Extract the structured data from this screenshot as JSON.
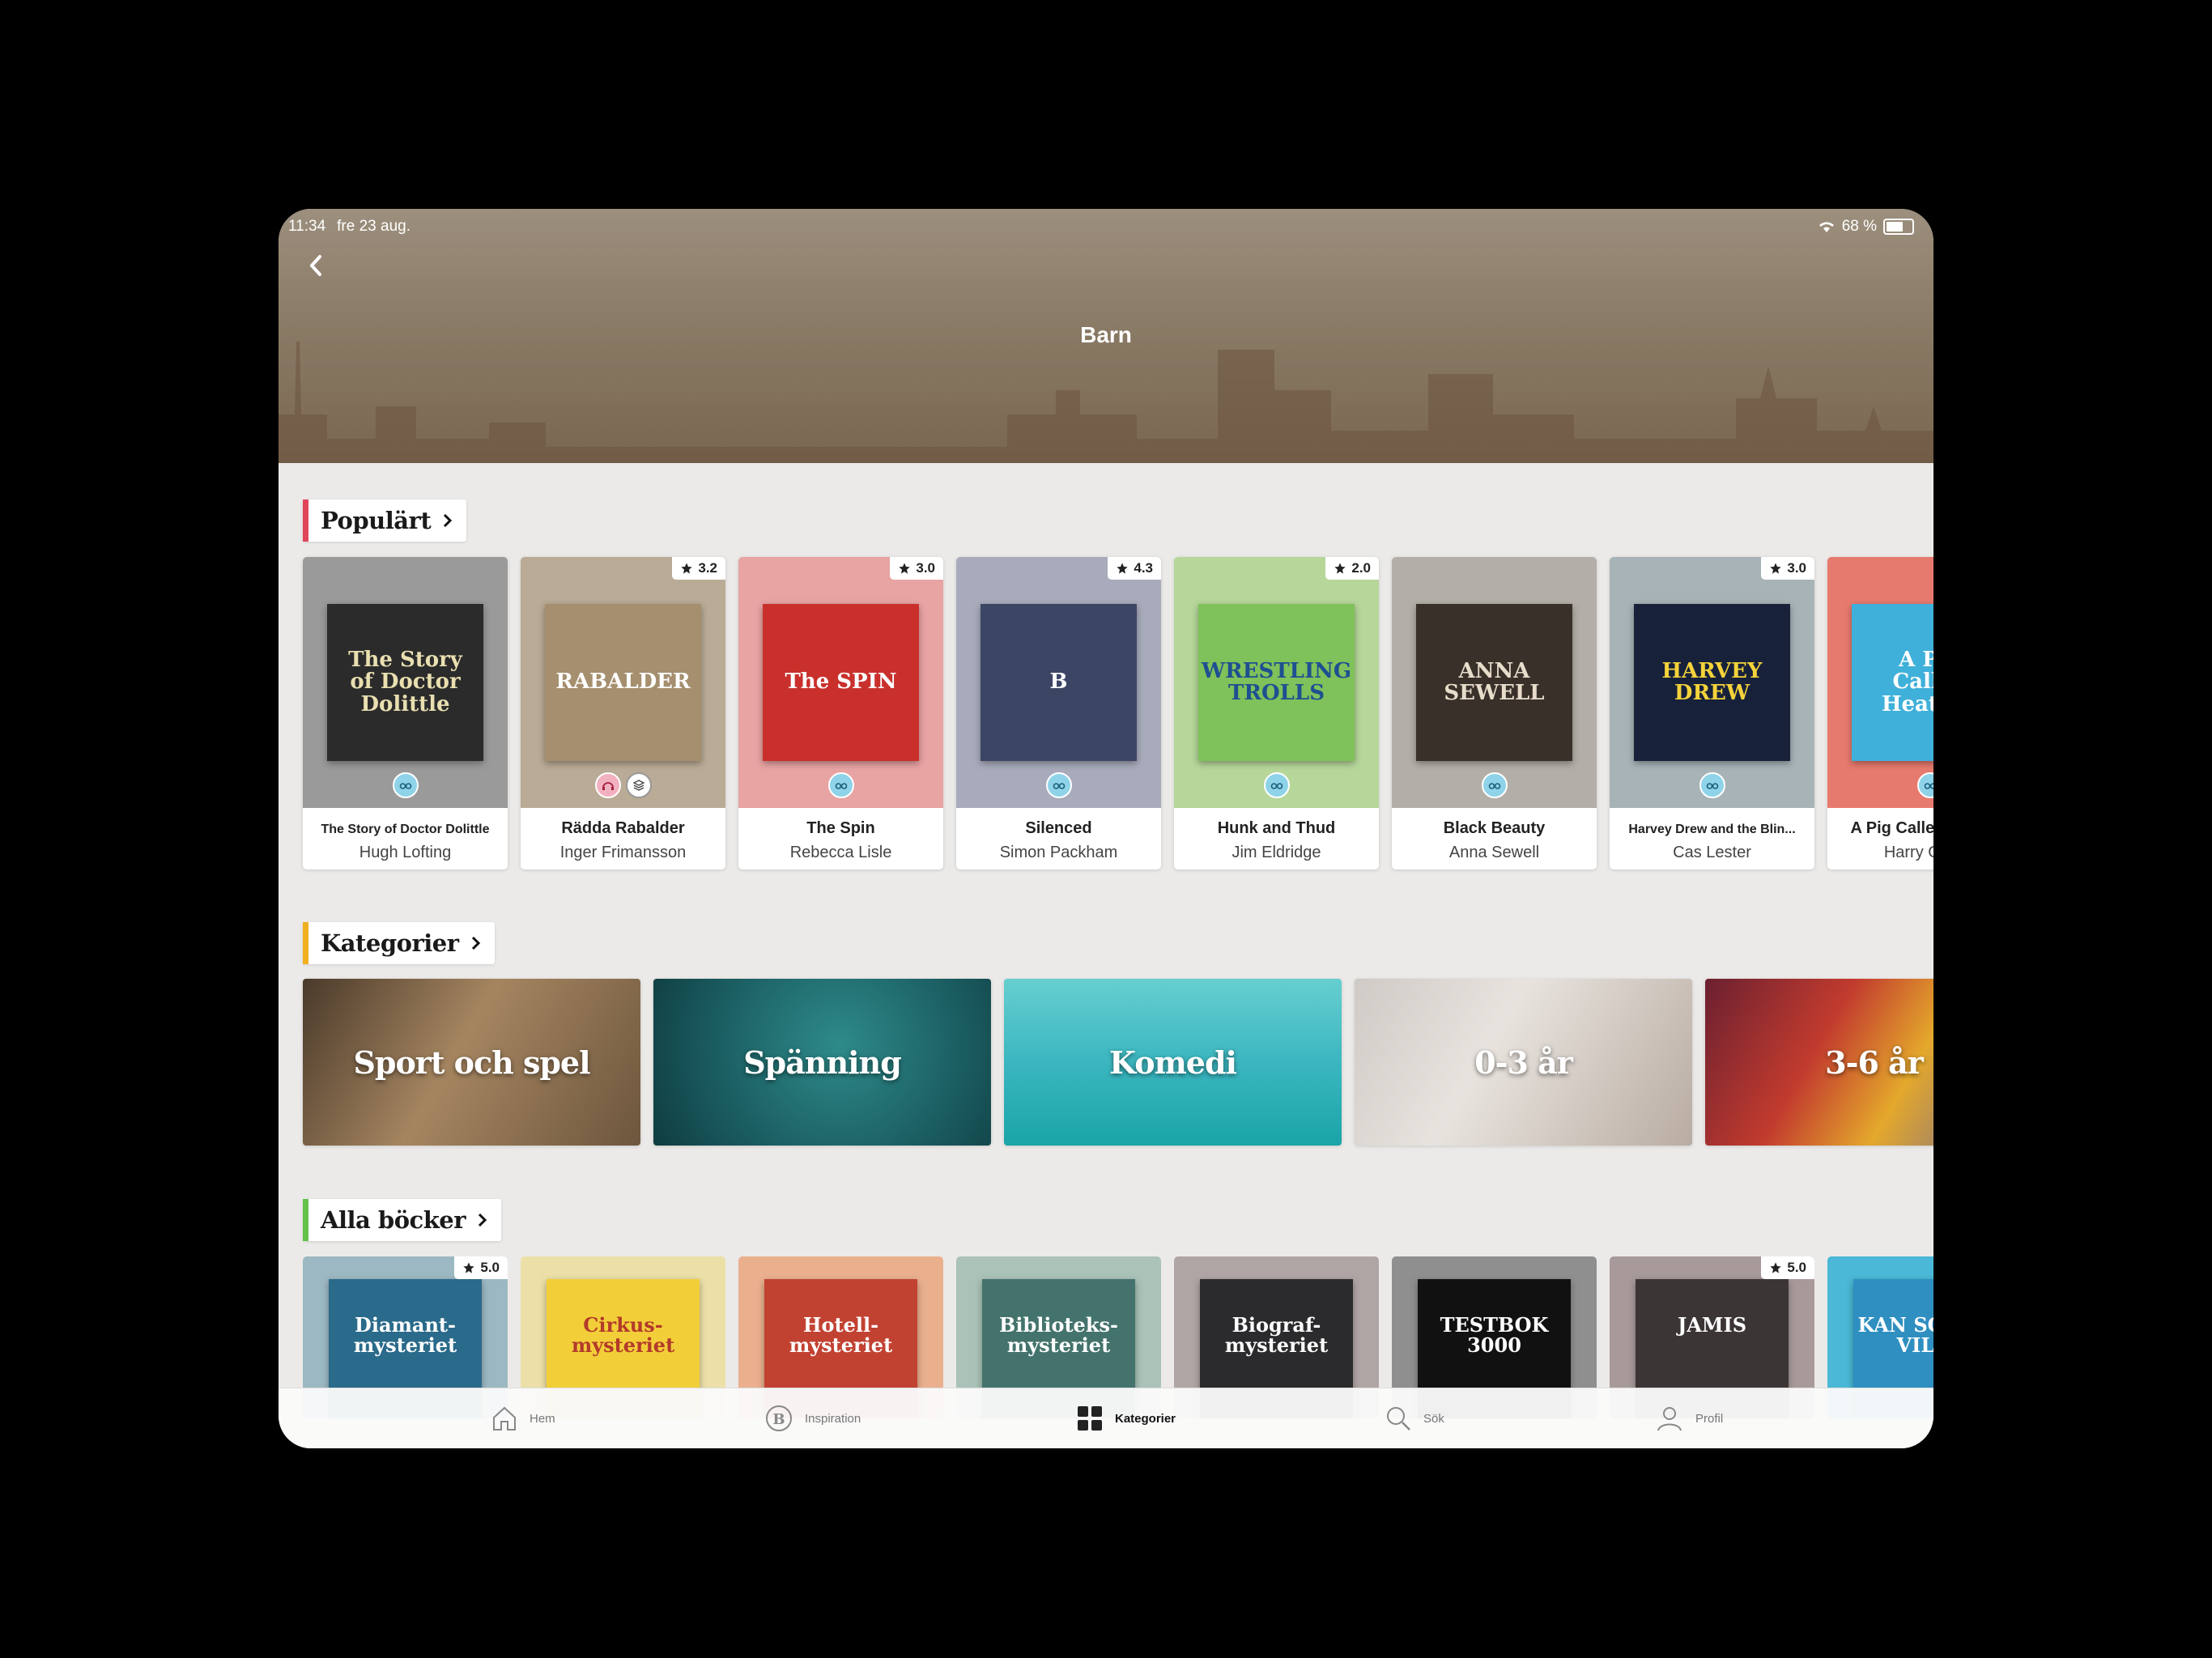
{
  "status": {
    "time": "11:34",
    "date": "fre 23 aug.",
    "battery": "68 %"
  },
  "header": {
    "title": "Barn"
  },
  "popular": {
    "title": "Populärt",
    "accent": "#e0455a",
    "books": [
      {
        "title": "The Story of Doctor Dolittle",
        "author": "Hugh Lofting",
        "rating": "",
        "cover_text": "The Story of Doctor Dolittle",
        "bg": "#9a9a9a",
        "cover": "#2b2b2b",
        "fg": "#e9dfb0",
        "formats": [
          "ebook"
        ]
      },
      {
        "title": "Rädda Rabalder",
        "author": "Inger Frimansson",
        "rating": "3.2",
        "cover_text": "RABALDER",
        "bg": "#b9ab96",
        "cover": "#a58f6f",
        "fg": "#ffffff",
        "formats": [
          "audio",
          "stack"
        ]
      },
      {
        "title": "The Spin",
        "author": "Rebecca Lisle",
        "rating": "3.0",
        "cover_text": "The SPIN",
        "bg": "#e8a3a3",
        "cover": "#c9302c",
        "fg": "#ffffff",
        "formats": [
          "ebook"
        ]
      },
      {
        "title": "Silenced",
        "author": "Simon Packham",
        "rating": "4.3",
        "cover_text": "B",
        "bg": "#a8abbb",
        "cover": "#3c4564",
        "fg": "#ffffff",
        "formats": [
          "ebook"
        ]
      },
      {
        "title": "Hunk and Thud",
        "author": "Jim Eldridge",
        "rating": "2.0",
        "cover_text": "WRESTLING TROLLS",
        "bg": "#b6d69a",
        "cover": "#7fc15a",
        "fg": "#1e4f91",
        "formats": [
          "ebook"
        ]
      },
      {
        "title": "Black Beauty",
        "author": "Anna Sewell",
        "rating": "",
        "cover_text": "ANNA SEWELL",
        "bg": "#b3aea8",
        "cover": "#3a302a",
        "fg": "#e8dccb",
        "formats": [
          "ebook"
        ]
      },
      {
        "title": "Harvey Drew and the Blin...",
        "author": "Cas Lester",
        "rating": "3.0",
        "cover_text": "HARVEY DREW",
        "bg": "#a7b3b7",
        "cover": "#17213a",
        "fg": "#f5d33a",
        "formats": [
          "ebook"
        ]
      },
      {
        "title": "A Pig Called Heather",
        "author": "Harry Oulton",
        "rating": "",
        "cover_text": "A Pig Called Heather",
        "bg": "#e77a6e",
        "cover": "#3fb0d9",
        "fg": "#ffffff",
        "formats": [
          "ebook"
        ]
      }
    ]
  },
  "categories": {
    "title": "Kategorier",
    "accent": "#f0b020",
    "items": [
      {
        "label": "Sport och spel",
        "bg": "linear-gradient(120deg,#4a3a2a 0%,#a58560 45%,#6d563d 100%)"
      },
      {
        "label": "Spänning",
        "bg": "radial-gradient(circle at 55% 40%,#2e8a8a 0%,#1a5c60 60%,#0f3c40 100%)"
      },
      {
        "label": "Komedi",
        "bg": "linear-gradient(180deg,#66cfd0 0%,#3bb6c0 50%,#1aa5a8 100%)"
      },
      {
        "label": "0-3 år",
        "bg": "linear-gradient(120deg,#cfcac5 0%,#e8e3de 40%,#b9aca2 100%)"
      },
      {
        "label": "3-6 år",
        "bg": "linear-gradient(120deg,#6b2030 0%,#c23b2e 35%,#e4a82c 60%,#5a5ba6 100%)"
      }
    ]
  },
  "all_books": {
    "title": "Alla böcker",
    "accent": "#62c24a",
    "books": [
      {
        "rating": "5.0",
        "cover_text": "Diamant-mysteriet",
        "bg": "#9cb8c2",
        "cover": "#2a6a8a",
        "fg": "#ffffff"
      },
      {
        "rating": "",
        "cover_text": "Cirkus-mysteriet",
        "bg": "#ece0a8",
        "cover": "#f2cf38",
        "fg": "#b33a2b"
      },
      {
        "rating": "",
        "cover_text": "Hotell-mysteriet",
        "bg": "#eab08e",
        "cover": "#c24232",
        "fg": "#ffffff"
      },
      {
        "rating": "",
        "cover_text": "Biblioteks-mysteriet",
        "bg": "#aac2b8",
        "cover": "#43736c",
        "fg": "#ffffff"
      },
      {
        "rating": "",
        "cover_text": "Biograf-mysteriet",
        "bg": "#b0a5a5",
        "cover": "#2b2a2c",
        "fg": "#ffffff"
      },
      {
        "rating": "",
        "cover_text": "TESTBOK 3000",
        "bg": "#8f8f8f",
        "cover": "#111111",
        "fg": "#ffffff"
      },
      {
        "rating": "5.0",
        "cover_text": "JAMIS",
        "bg": "#a89a9a",
        "cover": "#3c3535",
        "fg": "#ffffff"
      },
      {
        "rating": "",
        "cover_text": "KAN SOM SÅ VILLE",
        "bg": "#4ab8d6",
        "cover": "#2f8fc0",
        "fg": "#ffffff"
      }
    ]
  },
  "tabs": [
    {
      "label": "Hem",
      "icon": "home-icon"
    },
    {
      "label": "Inspiration",
      "icon": "inspiration-icon"
    },
    {
      "label": "Kategorier",
      "icon": "grid-icon",
      "active": true
    },
    {
      "label": "Sök",
      "icon": "search-icon"
    },
    {
      "label": "Profil",
      "icon": "profile-icon"
    }
  ]
}
